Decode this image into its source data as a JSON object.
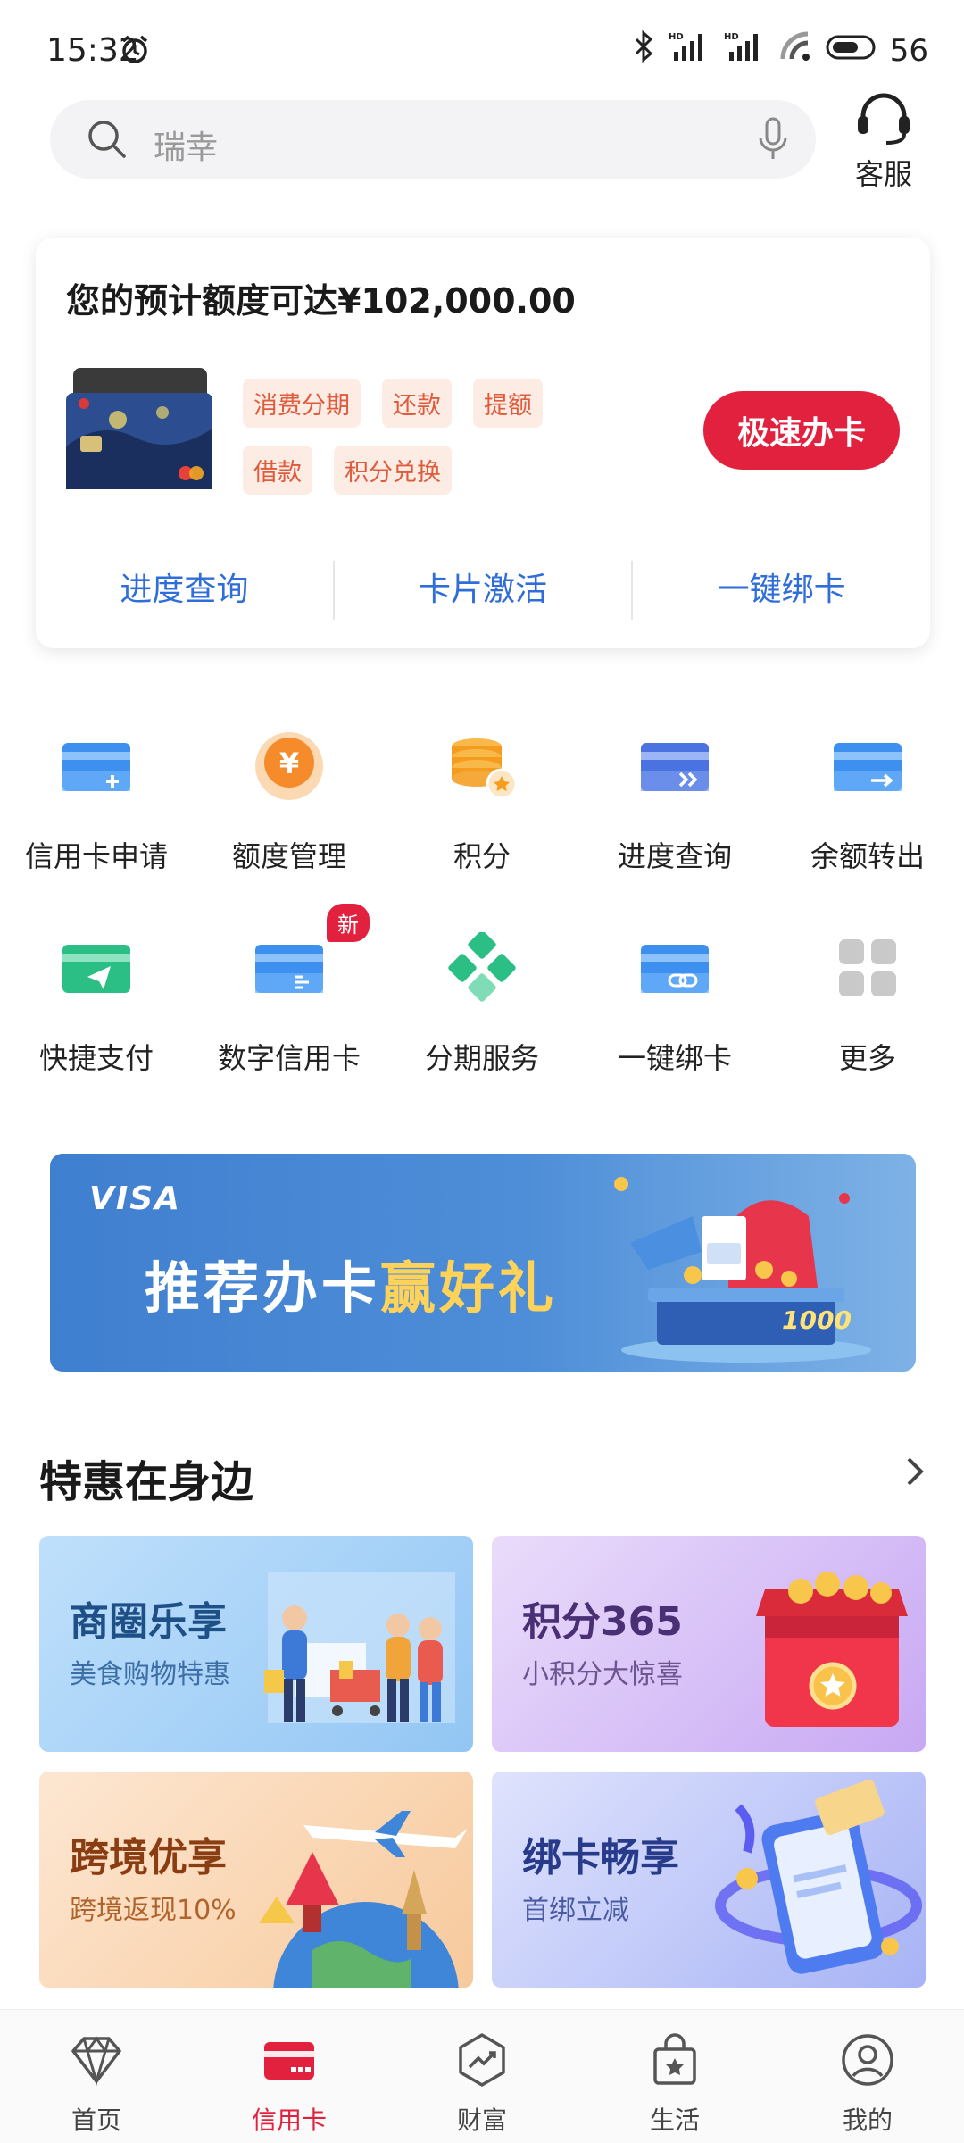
{
  "status_bar": {
    "time": "15:32",
    "battery": "56"
  },
  "search": {
    "placeholder": "瑞幸"
  },
  "header": {
    "service_label": "客服"
  },
  "card_panel": {
    "title": "您的预计额度可达¥102,000.00",
    "tags": [
      "消费分期",
      "还款",
      "提额",
      "借款",
      "积分兑换"
    ],
    "apply_button": "极速办卡",
    "links": [
      "进度查询",
      "卡片激活",
      "一键绑卡"
    ]
  },
  "grid": {
    "row1": [
      {
        "label": "信用卡申请",
        "icon": "card-add-icon"
      },
      {
        "label": "额度管理",
        "icon": "yuan-coin-icon"
      },
      {
        "label": "积分",
        "icon": "points-stack-icon"
      },
      {
        "label": "进度查询",
        "icon": "card-progress-icon"
      },
      {
        "label": "余额转出",
        "icon": "card-transfer-icon"
      }
    ],
    "row2": [
      {
        "label": "快捷支付",
        "icon": "quick-pay-icon"
      },
      {
        "label": "数字信用卡",
        "icon": "digital-card-icon",
        "badge": "新"
      },
      {
        "label": "分期服务",
        "icon": "installment-icon"
      },
      {
        "label": "一键绑卡",
        "icon": "card-link-icon"
      },
      {
        "label": "更多",
        "icon": "more-grid-icon"
      }
    ]
  },
  "banner": {
    "brand": "VISA",
    "text_main": "推荐办卡",
    "text_highlight": "赢好礼",
    "prize": "1000"
  },
  "section": {
    "title": "特惠在身边",
    "tiles": [
      {
        "title": "商圈乐享",
        "subtitle": "美食购物特惠"
      },
      {
        "title": "积分365",
        "subtitle": "小积分大惊喜"
      },
      {
        "title": "跨境优享",
        "subtitle": "跨境返现10%"
      },
      {
        "title": "绑卡畅享",
        "subtitle": "首绑立减"
      }
    ]
  },
  "tab_bar": {
    "tabs": [
      {
        "label": "首页",
        "icon": "diamond-icon"
      },
      {
        "label": "信用卡",
        "icon": "credit-card-icon",
        "active": true
      },
      {
        "label": "财富",
        "icon": "wealth-chart-icon"
      },
      {
        "label": "生活",
        "icon": "shopping-bag-icon"
      },
      {
        "label": "我的",
        "icon": "user-icon"
      }
    ]
  },
  "colors": {
    "accent": "#e1213e",
    "link": "#2f6ed8",
    "tag_bg": "#fdece4",
    "tag_text": "#e05a3c"
  }
}
